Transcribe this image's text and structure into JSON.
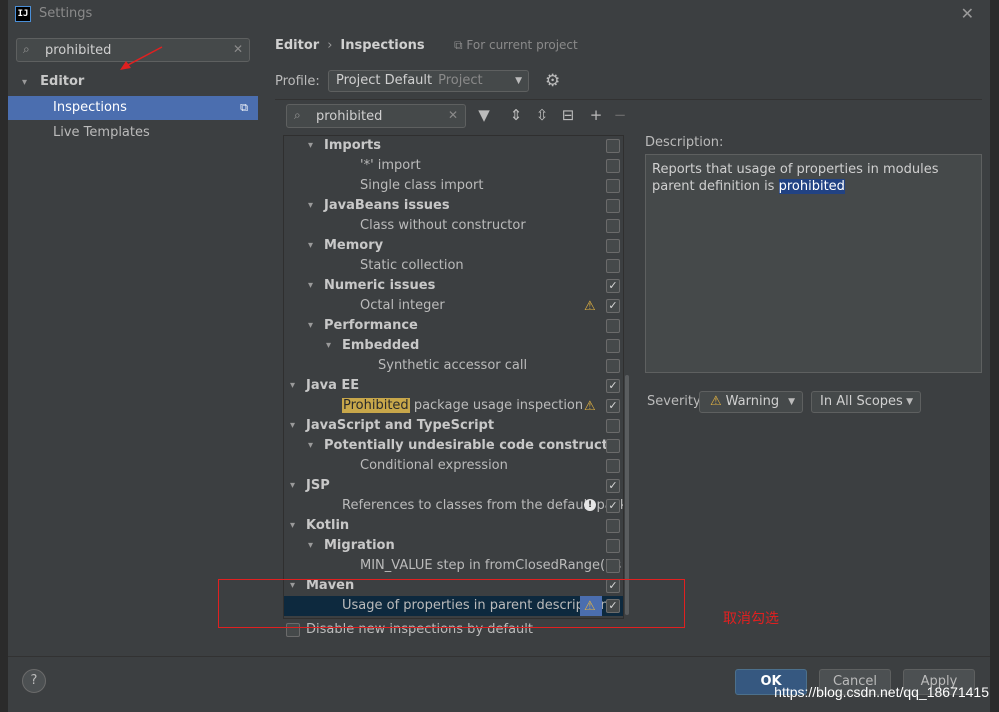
{
  "window": {
    "title": "Settings",
    "app_icon_text": "IJ"
  },
  "search": {
    "value": "prohibited"
  },
  "nav": {
    "group": "Editor",
    "items": [
      {
        "label": "Inspections",
        "selected": true
      },
      {
        "label": "Live Templates",
        "selected": false
      }
    ]
  },
  "header": {
    "crumb_1": "Editor",
    "crumb_sep": "›",
    "crumb_2": "Inspections",
    "for_project": "For current project"
  },
  "profile": {
    "label": "Profile:",
    "value": "Project Default",
    "sub": "Project"
  },
  "filter": {
    "value": "prohibited"
  },
  "tree_rows": [
    {
      "indent": 1,
      "toggle": "▾",
      "label": "Imports",
      "bold": true,
      "checked": false
    },
    {
      "indent": 3,
      "label": "'*' import",
      "checked": false
    },
    {
      "indent": 3,
      "label": "Single class import",
      "checked": false
    },
    {
      "indent": 1,
      "toggle": "▾",
      "label": "JavaBeans issues",
      "bold": true,
      "checked": false
    },
    {
      "indent": 3,
      "label": "Class without constructor",
      "checked": false
    },
    {
      "indent": 1,
      "toggle": "▾",
      "label": "Memory",
      "bold": true,
      "checked": false
    },
    {
      "indent": 3,
      "label": "Static collection",
      "checked": false
    },
    {
      "indent": 1,
      "toggle": "▾",
      "label": "Numeric issues",
      "bold": true,
      "checked": true
    },
    {
      "indent": 3,
      "label": "Octal integer",
      "checked": true,
      "severity": "warn"
    },
    {
      "indent": 1,
      "toggle": "▾",
      "label": "Performance",
      "bold": true,
      "checked": false
    },
    {
      "indent": 2,
      "toggle": "▾",
      "label": "Embedded",
      "bold": true,
      "checked": false
    },
    {
      "indent": 4,
      "label": "Synthetic accessor call",
      "checked": false
    },
    {
      "indent": 0,
      "toggle": "▾",
      "label": "Java EE",
      "bold": true,
      "checked": true
    },
    {
      "indent": 2,
      "label_match": "Prohibited",
      "label": " package usage inspection",
      "checked": true,
      "severity": "warn"
    },
    {
      "indent": 0,
      "toggle": "▾",
      "label": "JavaScript and TypeScript",
      "bold": true,
      "checked": false
    },
    {
      "indent": 1,
      "toggle": "▾",
      "label": "Potentially undesirable code constructs",
      "bold": true,
      "checked": false
    },
    {
      "indent": 3,
      "label": "Conditional expression",
      "checked": false
    },
    {
      "indent": 0,
      "toggle": "▾",
      "label": "JSP",
      "bold": true,
      "checked": true
    },
    {
      "indent": 2,
      "label": "References to classes from the default packa",
      "checked": true,
      "severity": "error"
    },
    {
      "indent": 0,
      "toggle": "▾",
      "label": "Kotlin",
      "bold": true,
      "checked": false
    },
    {
      "indent": 1,
      "toggle": "▾",
      "label": "Migration",
      "bold": true,
      "checked": false
    },
    {
      "indent": 3,
      "label": "MIN_VALUE step in fromClosedRange() s",
      "checked": false
    },
    {
      "indent": 0,
      "toggle": "▾",
      "label": "Maven",
      "bold": true,
      "checked": true
    },
    {
      "indent": 2,
      "label": "Usage of properties in parent description",
      "checked": true,
      "severity": "warn",
      "highlighted": true
    }
  ],
  "disable_new": {
    "label": "Disable new inspections by default",
    "checked": false
  },
  "description": {
    "label": "Description:",
    "text_before": "Reports that usage of properties in modules parent definition is ",
    "text_selected": "prohibited"
  },
  "severity": {
    "label": "Severity:",
    "value": "Warning",
    "scope": "In All Scopes"
  },
  "buttons": {
    "help": "?",
    "ok": "OK",
    "cancel": "Cancel",
    "apply": "Apply"
  },
  "annotation": {
    "note": "取消勾选"
  },
  "watermark": "https://blog.csdn.net/qq_18671415",
  "colors": {
    "accent": "#4b6eaf",
    "annotation": "#e02020",
    "warning": "#e3b341"
  }
}
